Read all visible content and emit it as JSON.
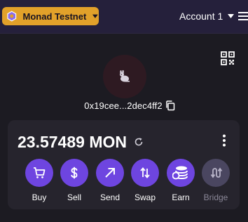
{
  "header": {
    "network_label": "Monad Testnet",
    "account_label": "Account 1"
  },
  "wallet": {
    "address": "0x19cee...2dec4ff2",
    "balance": "23.57489 MON"
  },
  "actions": [
    {
      "label": "Buy",
      "icon": "cart-icon",
      "enabled": true
    },
    {
      "label": "Sell",
      "icon": "dollar-icon",
      "enabled": true
    },
    {
      "label": "Send",
      "icon": "arrow-up-right-icon",
      "enabled": true
    },
    {
      "label": "Swap",
      "icon": "swap-arrows-icon",
      "enabled": true
    },
    {
      "label": "Earn",
      "icon": "coins-stack-icon",
      "enabled": true
    },
    {
      "label": "Bridge",
      "icon": "bridge-arrows-icon",
      "enabled": false
    }
  ],
  "colors": {
    "background": "#1c1b22",
    "topbar": "#25203b",
    "network_badge": "#e2a12a",
    "accent": "#6e45e0",
    "card": "#26242d"
  }
}
